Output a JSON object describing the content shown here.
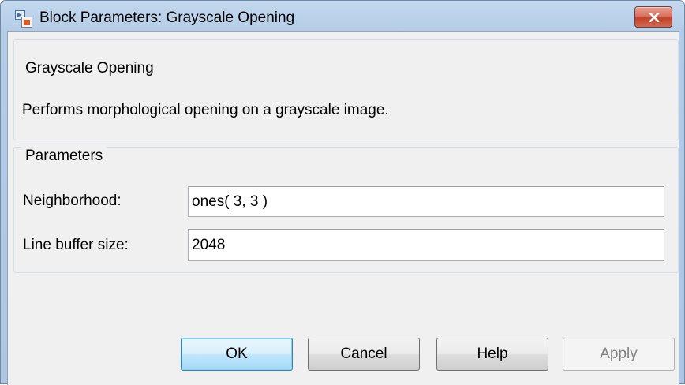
{
  "window": {
    "title": "Block Parameters: Grayscale Opening",
    "icon": "simulink-block-icon",
    "close_icon": "close-x-icon"
  },
  "description_group": {
    "legend": "Grayscale Opening",
    "text": "Performs morphological opening on a grayscale image."
  },
  "parameters_group": {
    "legend": "Parameters",
    "fields": [
      {
        "label": "Neighborhood:",
        "value": "ones( 3, 3 )"
      },
      {
        "label": "Line buffer size:",
        "value": "2048"
      }
    ]
  },
  "buttons": {
    "ok": "OK",
    "cancel": "Cancel",
    "help": "Help",
    "apply": "Apply"
  },
  "colors": {
    "titlebar": "#b4cce6",
    "close_button": "#c2412a",
    "dialog_background": "#f0f0f0",
    "default_button_border": "#3c7fb1"
  }
}
